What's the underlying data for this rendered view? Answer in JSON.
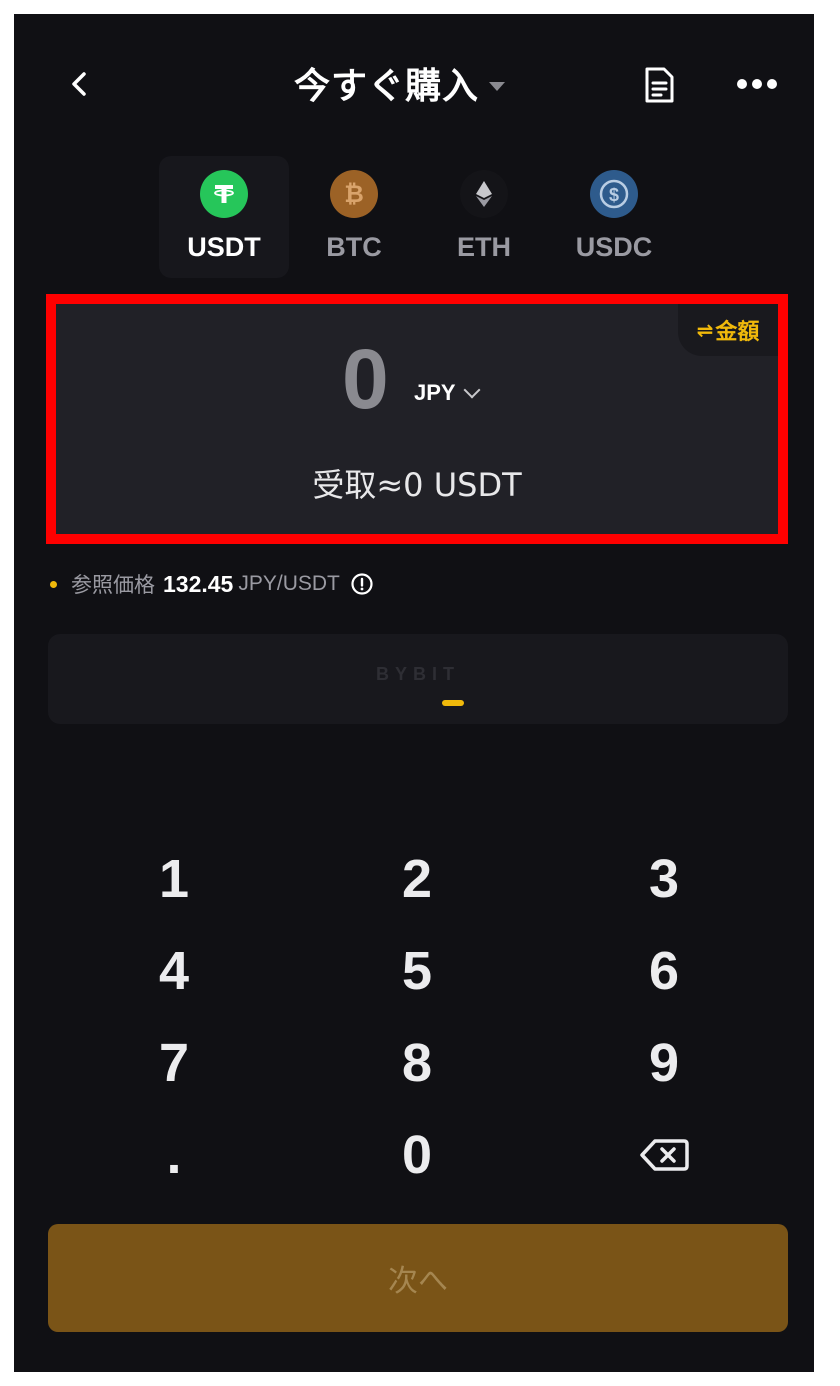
{
  "header": {
    "title": "今すぐ購入"
  },
  "coins": [
    {
      "label": "USDT",
      "icon": "tether-icon",
      "color": "#26c65a",
      "active": true
    },
    {
      "label": "BTC",
      "icon": "bitcoin-icon",
      "color": "#9c6226",
      "active": false
    },
    {
      "label": "ETH",
      "icon": "ethereum-icon",
      "color": "#141418",
      "active": false
    },
    {
      "label": "USDC",
      "icon": "usd-coin-icon",
      "color": "#2e5b8c",
      "active": false
    }
  ],
  "amount": {
    "toggle_label": "金額",
    "toggle_icon": "⇌",
    "value": "0",
    "currency": "JPY",
    "receive_text": "受取≈0 USDT"
  },
  "reference": {
    "label": "参照価格",
    "value": "132.45",
    "unit": "JPY/USDT"
  },
  "banner": {
    "logo": "BYBIT"
  },
  "keypad": {
    "keys": [
      "1",
      "2",
      "3",
      "4",
      "5",
      "6",
      "7",
      "8",
      "9",
      ".",
      "0"
    ]
  },
  "next_button": {
    "label": "次へ"
  },
  "colors": {
    "background": "#101014",
    "accent": "#f0b90b",
    "highlight_border": "#ff0000",
    "button": "#7a5417"
  }
}
